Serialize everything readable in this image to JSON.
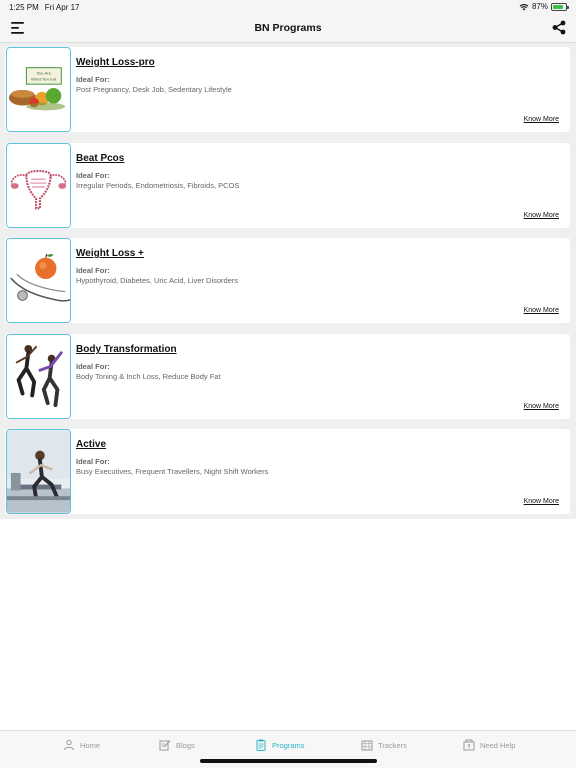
{
  "status_bar": {
    "time": "1:25 PM",
    "date": "Fri Apr 17",
    "battery_text": "87%",
    "battery_level": 0.87
  },
  "header": {
    "title": "BN Programs",
    "menu_icon": "hamburger-icon",
    "share_icon": "share-icon"
  },
  "programs": [
    {
      "title": "Weight Loss-pro",
      "ideal_label": "Ideal For:",
      "ideal_text": "Post Pregnancy, Desk Job, Sedentary Lifestyle",
      "cta": "Know More",
      "thumb_sign": "You Are What You Eat"
    },
    {
      "title": "Beat Pcos",
      "ideal_label": "Ideal For:",
      "ideal_text": "Irregular Periods, Endometriosis, Fibroids, PCOS",
      "cta": "Know More"
    },
    {
      "title": "Weight Loss +",
      "ideal_label": "Ideal For:",
      "ideal_text": "Hypothyroid, Diabetes, Uric Acid, Liver Disorders",
      "cta": "Know More"
    },
    {
      "title": "Body Transformation",
      "ideal_label": "Ideal For:",
      "ideal_text": "Body Toning & Inch Loss, Reduce Body Fat",
      "cta": "Know More"
    },
    {
      "title": "Active",
      "ideal_label": "Ideal For:",
      "ideal_text": "Busy Executives, Frequent Travellers, Night Shift Workers",
      "cta": "Know More"
    }
  ],
  "tabs": [
    {
      "label": "Home",
      "icon": "home-icon",
      "active": false
    },
    {
      "label": "Blogs",
      "icon": "blogs-icon",
      "active": false
    },
    {
      "label": "Programs",
      "icon": "clipboard-icon",
      "active": true
    },
    {
      "label": "Trackers",
      "icon": "calendar-icon",
      "active": false
    },
    {
      "label": "Need Help",
      "icon": "help-icon",
      "active": false
    }
  ],
  "colors": {
    "accent": "#2bb3c6",
    "thumb_border": "#5ec4d8",
    "list_background": "#efefef",
    "battery": "#3cc24a"
  }
}
